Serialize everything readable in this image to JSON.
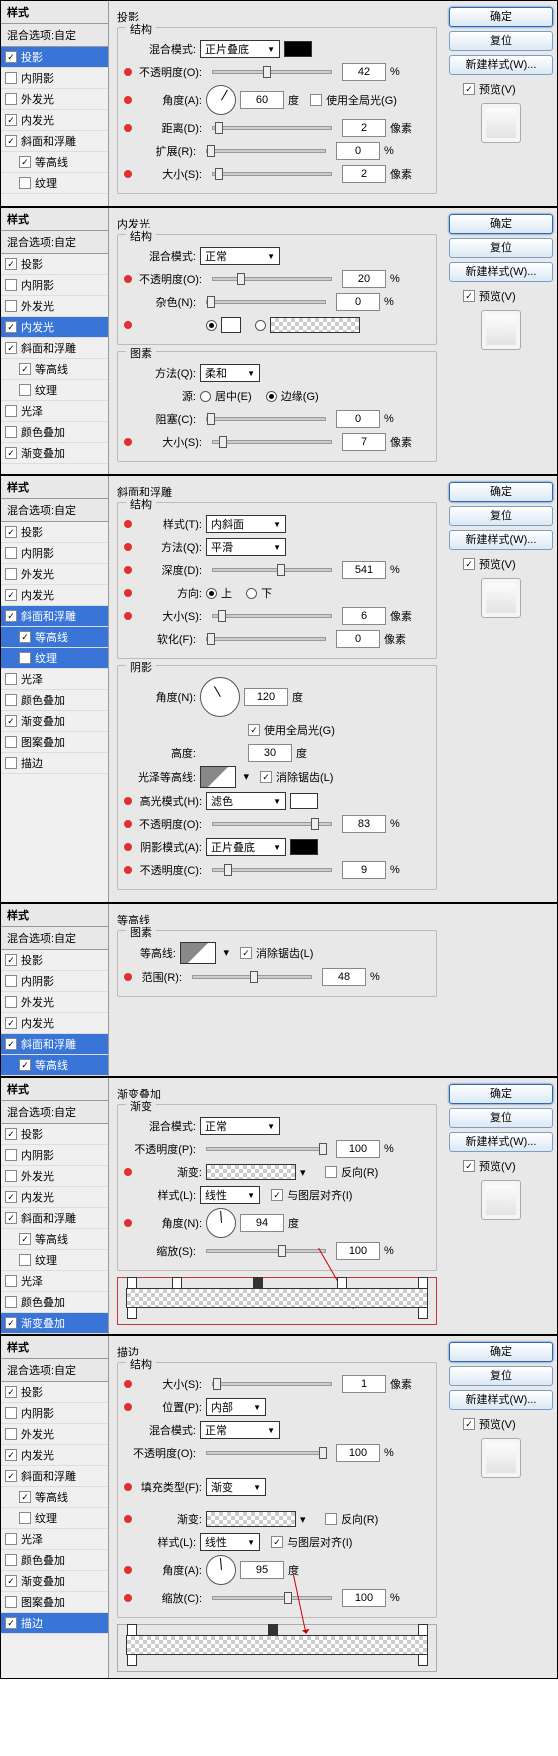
{
  "common": {
    "styles_header": "样式",
    "blend_header": "混合选项:自定",
    "btn_ok": "确定",
    "btn_reset": "复位",
    "btn_new": "新建样式(W)...",
    "preview": "预览(V)"
  },
  "labels": {
    "drop_shadow": "投影",
    "inner_shadow": "内阴影",
    "outer_glow": "外发光",
    "inner_glow": "内发光",
    "bevel": "斜面和浮雕",
    "contour": "等高线",
    "texture": "纹理",
    "satin": "光泽",
    "color_overlay": "颜色叠加",
    "grad_overlay": "渐变叠加",
    "pattern_overlay": "图案叠加",
    "stroke": "描边"
  },
  "p1": {
    "title": "投影",
    "struct": "结构",
    "blend_mode": "混合模式:",
    "blend_val": "正片叠底",
    "opacity": "不透明度(O):",
    "opacity_val": "42",
    "pct": "%",
    "angle": "角度(A):",
    "angle_val": "60",
    "deg": "度",
    "global": "使用全局光(G)",
    "distance": "距离(D):",
    "distance_val": "2",
    "px": "像素",
    "spread": "扩展(R):",
    "spread_val": "0",
    "size": "大小(S):",
    "size_val": "2"
  },
  "p2": {
    "title": "内发光",
    "struct": "结构",
    "blend_mode": "混合模式:",
    "blend_val": "正常",
    "opacity": "不透明度(O):",
    "opacity_val": "20",
    "pct": "%",
    "noise": "杂色(N):",
    "noise_val": "0",
    "elements": "图素",
    "technique": "方法(Q):",
    "technique_val": "柔和",
    "source": "源:",
    "center": "居中(E)",
    "edge": "边缘(G)",
    "choke": "阻塞(C):",
    "choke_val": "0",
    "size": "大小(S):",
    "size_val": "7",
    "px": "像素"
  },
  "p3": {
    "title": "斜面和浮雕",
    "struct": "结构",
    "style": "样式(T):",
    "style_val": "内斜面",
    "technique": "方法(Q):",
    "technique_val": "平滑",
    "depth": "深度(D):",
    "depth_val": "541",
    "pct": "%",
    "direction": "方向:",
    "up": "上",
    "down": "下",
    "size": "大小(S):",
    "size_val": "6",
    "px": "像素",
    "soften": "软化(F):",
    "soften_val": "0",
    "shading": "阴影",
    "angle": "角度(N):",
    "angle_val": "120",
    "deg": "度",
    "global": "使用全局光(G)",
    "altitude": "高度:",
    "altitude_val": "30",
    "gloss_contour": "光泽等高线:",
    "antialias": "消除锯齿(L)",
    "hl_mode": "高光模式(H):",
    "hl_val": "滤色",
    "hl_opacity": "不透明度(O):",
    "hl_opacity_val": "83",
    "sh_mode": "阴影模式(A):",
    "sh_val": "正片叠底",
    "sh_opacity": "不透明度(C):",
    "sh_opacity_val": "9"
  },
  "p4": {
    "title": "等高线",
    "elements": "图素",
    "contour": "等高线:",
    "antialias": "消除锯齿(L)",
    "range": "范围(R):",
    "range_val": "48",
    "pct": "%"
  },
  "p5": {
    "title": "渐变叠加",
    "grad": "渐变",
    "blend_mode": "混合模式:",
    "blend_val": "正常",
    "opacity": "不透明度(P):",
    "opacity_val": "100",
    "pct": "%",
    "gradient": "渐变:",
    "reverse": "反向(R)",
    "style": "样式(L):",
    "style_val": "线性",
    "align": "与图层对齐(I)",
    "angle": "角度(N):",
    "angle_val": "94",
    "deg": "度",
    "scale": "缩放(S):",
    "scale_val": "100"
  },
  "p6": {
    "title": "描边",
    "struct": "结构",
    "size": "大小(S):",
    "size_val": "1",
    "px": "像素",
    "position": "位置(P):",
    "position_val": "内部",
    "blend_mode": "混合模式:",
    "blend_val": "正常",
    "opacity": "不透明度(O):",
    "opacity_val": "100",
    "pct": "%",
    "fill_type": "填充类型(F):",
    "fill_val": "渐变",
    "gradient": "渐变:",
    "reverse": "反向(R)",
    "style": "样式(L):",
    "style_val": "线性",
    "align": "与图层对齐(I)",
    "angle": "角度(A):",
    "angle_val": "95",
    "deg": "度",
    "scale": "缩放(C):",
    "scale_val": "100"
  }
}
